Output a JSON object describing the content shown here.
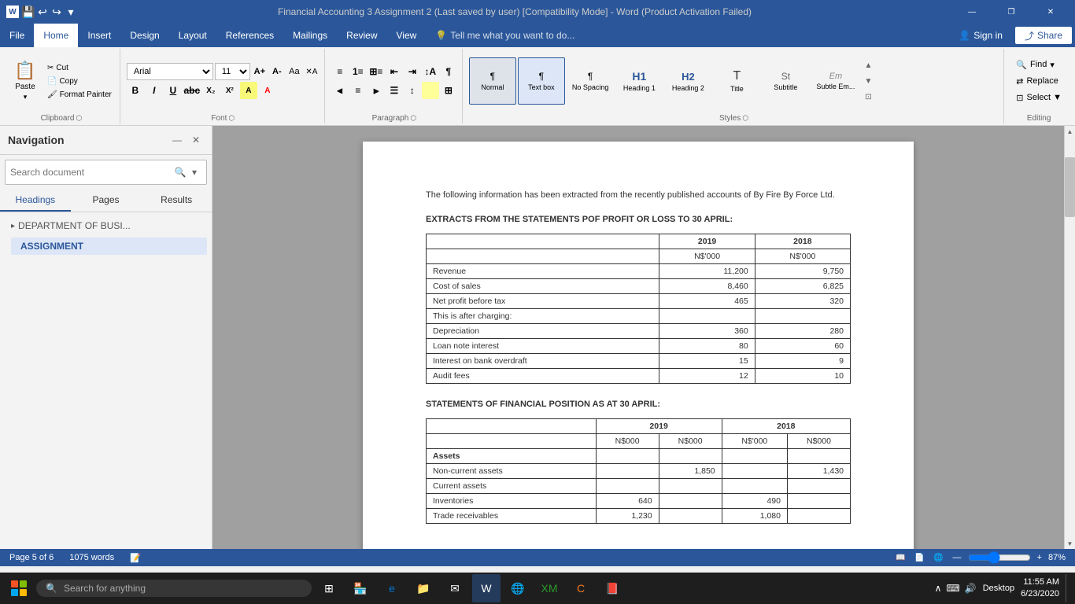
{
  "titleBar": {
    "title": "Financial Accounting 3 Assignment 2 (Last saved by user) [Compatibility Mode] - Word (Product Activation Failed)",
    "windowControls": [
      "—",
      "❐",
      "✕"
    ]
  },
  "menuBar": {
    "tabs": [
      "File",
      "Home",
      "Insert",
      "Design",
      "Layout",
      "References",
      "Mailings",
      "Review",
      "View"
    ],
    "activeTab": "Home",
    "tellMe": "Tell me what you want to do...",
    "signIn": "Sign in",
    "share": "Share"
  },
  "ribbon": {
    "clipboard": {
      "label": "Clipboard",
      "paste": "Paste",
      "cut": "Cut",
      "copy": "Copy",
      "formatPainter": "Format Painter"
    },
    "font": {
      "label": "Font",
      "fontName": "Arial",
      "fontSize": "11",
      "bold": "B",
      "italic": "I",
      "underline": "U",
      "strikethrough": "abc",
      "subscript": "X₂",
      "superscript": "X²"
    },
    "paragraph": {
      "label": "Paragraph"
    },
    "styles": {
      "label": "Styles",
      "items": [
        {
          "name": "Normal",
          "label": "¶ Normal",
          "active": true
        },
        {
          "name": "Text box",
          "label": "¶ Text box",
          "active": false
        },
        {
          "name": "No Spacing",
          "label": "No Spacing",
          "active": false
        },
        {
          "name": "Heading 1",
          "label": "Heading 1",
          "active": false
        },
        {
          "name": "Heading 2",
          "label": "Heading 2",
          "active": false
        },
        {
          "name": "Title",
          "label": "Title",
          "active": false
        },
        {
          "name": "Subtitle",
          "label": "Subtitle",
          "active": false
        },
        {
          "name": "Subtle Em...",
          "label": "Subtle Em...",
          "active": false
        }
      ]
    },
    "editing": {
      "label": "Editing",
      "find": "Find",
      "replace": "Replace",
      "select": "Select ▼"
    }
  },
  "navigation": {
    "title": "Navigation",
    "searchPlaceholder": "Search document",
    "tabs": [
      "Headings",
      "Pages",
      "Results"
    ],
    "activeTab": "Headings",
    "headings": [
      {
        "level": 1,
        "text": "DEPARTMENT OF BUSI...",
        "indent": 0
      },
      {
        "level": 2,
        "text": "ASSIGNMENT",
        "indent": 0,
        "active": true
      }
    ]
  },
  "document": {
    "intro": "The following information has been extracted from the recently published accounts of By Fire By Force Ltd.",
    "table1": {
      "heading": "EXTRACTS FROM THE STATEMENTS POF PROFIT OR LOSS TO 30 APRIL:",
      "headers": [
        "",
        "2019",
        "2018"
      ],
      "subheaders": [
        "",
        "N$'000",
        "N$'000"
      ],
      "rows": [
        [
          "Revenue",
          "11,200",
          "9,750"
        ],
        [
          "Cost of sales",
          "8,460",
          "6,825"
        ],
        [
          "Net profit before tax",
          "465",
          "320"
        ],
        [
          "This is after charging:",
          "",
          ""
        ],
        [
          "Depreciation",
          "360",
          "280"
        ],
        [
          "Loan note interest",
          "80",
          "60"
        ],
        [
          "Interest on bank overdraft",
          "15",
          "9"
        ],
        [
          "Audit fees",
          "12",
          "10"
        ]
      ]
    },
    "table2": {
      "heading": "STATEMENTS OF FINANCIAL POSITION AS AT 30 APRIL:",
      "headers": [
        "",
        "2019",
        "",
        "2018",
        ""
      ],
      "subheaders": [
        "",
        "N$000",
        "N$000",
        "N$'000",
        "N$000"
      ],
      "rows": [
        [
          "Assets",
          "",
          "",
          "",
          ""
        ],
        [
          "Non-current assets",
          "",
          "1,850",
          "",
          "1,430"
        ],
        [
          "Current assets",
          "",
          "",
          "",
          ""
        ],
        [
          "Inventories",
          "640",
          "",
          "490",
          ""
        ],
        [
          "Trade receivables",
          "1,230",
          "",
          "1,080",
          ""
        ]
      ]
    }
  },
  "statusBar": {
    "page": "Page 5 of 6",
    "words": "1075 words",
    "zoom": "87%"
  },
  "taskbar": {
    "searchPlaceholder": "Search for anything",
    "time": "11:55 AM",
    "date": "6/23/2020",
    "location": "Desktop"
  }
}
